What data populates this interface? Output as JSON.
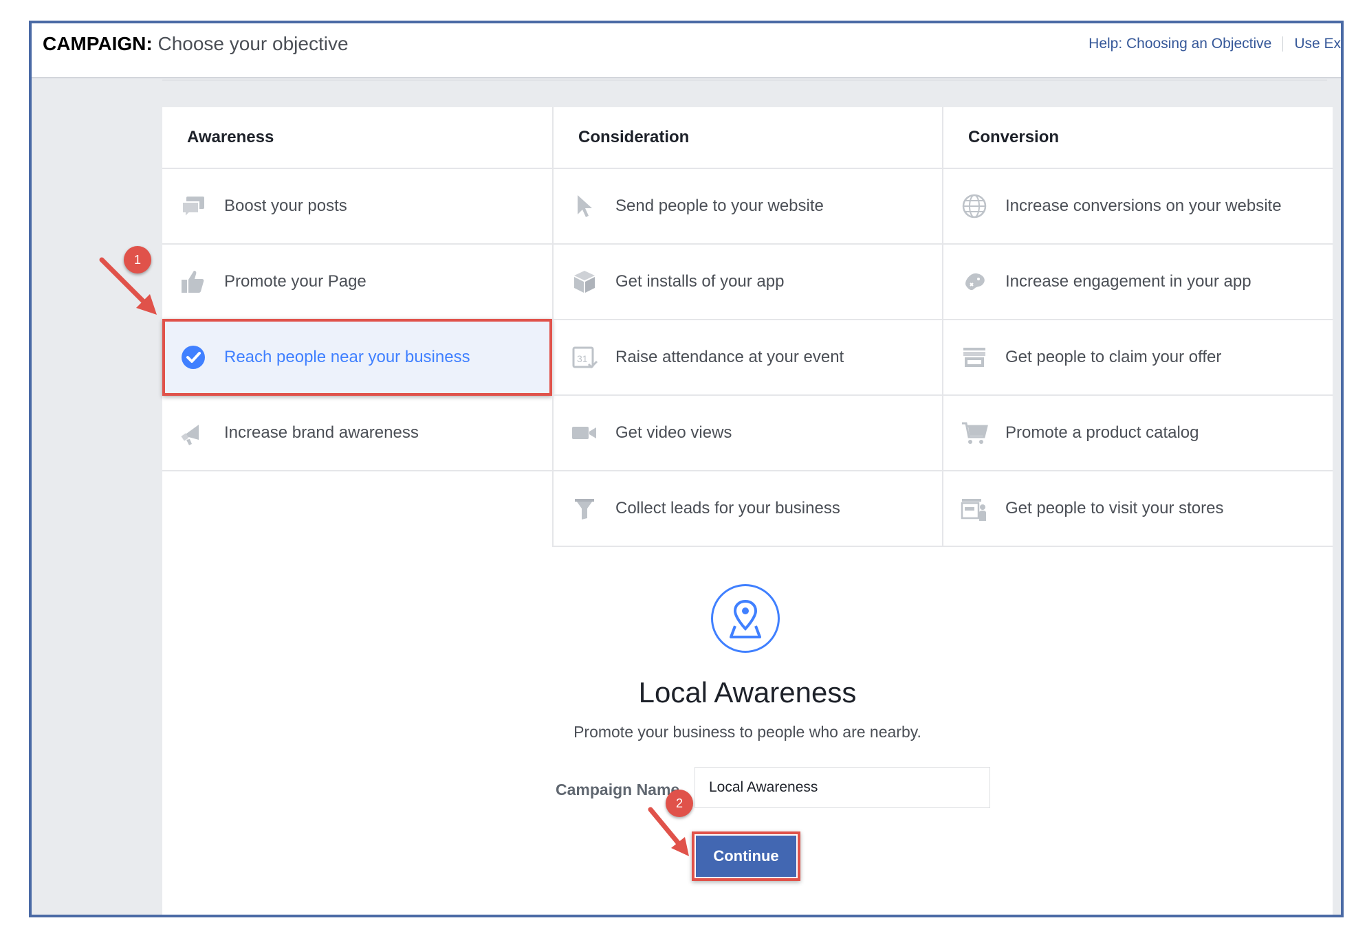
{
  "header": {
    "title_bold": "CAMPAIGN:",
    "title_rest": " Choose your objective",
    "help_link": "Help: Choosing an Objective",
    "use_link": "Use Ex"
  },
  "columns": [
    {
      "heading": "Awareness",
      "items": [
        {
          "label": "Boost your posts",
          "icon": "chat-bubbles-icon"
        },
        {
          "label": "Promote your Page",
          "icon": "thumbs-up-icon"
        },
        {
          "label": "Reach people near your business",
          "icon": "check-circle-icon",
          "selected": true
        },
        {
          "label": "Increase brand awareness",
          "icon": "megaphone-icon"
        }
      ]
    },
    {
      "heading": "Consideration",
      "items": [
        {
          "label": "Send people to your website",
          "icon": "cursor-icon"
        },
        {
          "label": "Get installs of your app",
          "icon": "box-icon"
        },
        {
          "label": "Raise attendance at your event",
          "icon": "calendar-icon"
        },
        {
          "label": "Get video views",
          "icon": "video-camera-icon"
        },
        {
          "label": "Collect leads for your business",
          "icon": "funnel-icon"
        }
      ]
    },
    {
      "heading": "Conversion",
      "items": [
        {
          "label": "Increase conversions on your website",
          "icon": "globe-icon"
        },
        {
          "label": "Increase engagement in your app",
          "icon": "gamepad-icon"
        },
        {
          "label": "Get people to claim your offer",
          "icon": "storefront-icon"
        },
        {
          "label": "Promote a product catalog",
          "icon": "shopping-cart-icon"
        },
        {
          "label": "Get people to visit your stores",
          "icon": "store-visit-icon"
        }
      ]
    }
  ],
  "detail": {
    "icon": "map-pin-icon",
    "title": "Local Awareness",
    "description": "Promote your business to people who are nearby.",
    "campaign_name_label": "Campaign Name",
    "campaign_name_value": "Local Awareness",
    "continue_label": "Continue"
  },
  "annotations": {
    "badge1": "1",
    "badge2": "2"
  },
  "colors": {
    "accent_blue": "#4080ff",
    "button_blue": "#4267b2",
    "annotation_red": "#e0524a",
    "icon_gray": "#bec3c9"
  }
}
